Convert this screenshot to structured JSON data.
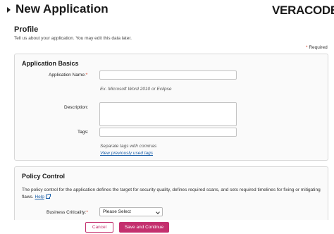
{
  "header": {
    "title": "New Application",
    "logo": "VERACODE"
  },
  "profile": {
    "title": "Profile",
    "description": "Tell us about your application. You may edit this data later.",
    "required_asterisk": "*",
    "required_label": "Required"
  },
  "basics": {
    "title": "Application Basics",
    "name_label": "Application Name:",
    "name_required": "*",
    "name_value": "",
    "name_hint": "Ex. Microsoft Word 2010 or Eclipse",
    "description_label": "Description:",
    "description_value": "",
    "tags_label": "Tags:",
    "tags_value": "",
    "tags_hint": "Separate tags with commas",
    "tags_link": "View previously used tags"
  },
  "policy": {
    "title": "Policy Control",
    "description": "The policy control for the application defines the target for security quality, defines required scans, and sets required timelines for fixing or mitigating flaws.",
    "help_link": "Help",
    "criticality_label": "Business Criticality:",
    "criticality_required": "*",
    "criticality_value": "Please Select"
  },
  "footer": {
    "cancel_label": "Cancel",
    "save_label": "Save and Continue"
  }
}
